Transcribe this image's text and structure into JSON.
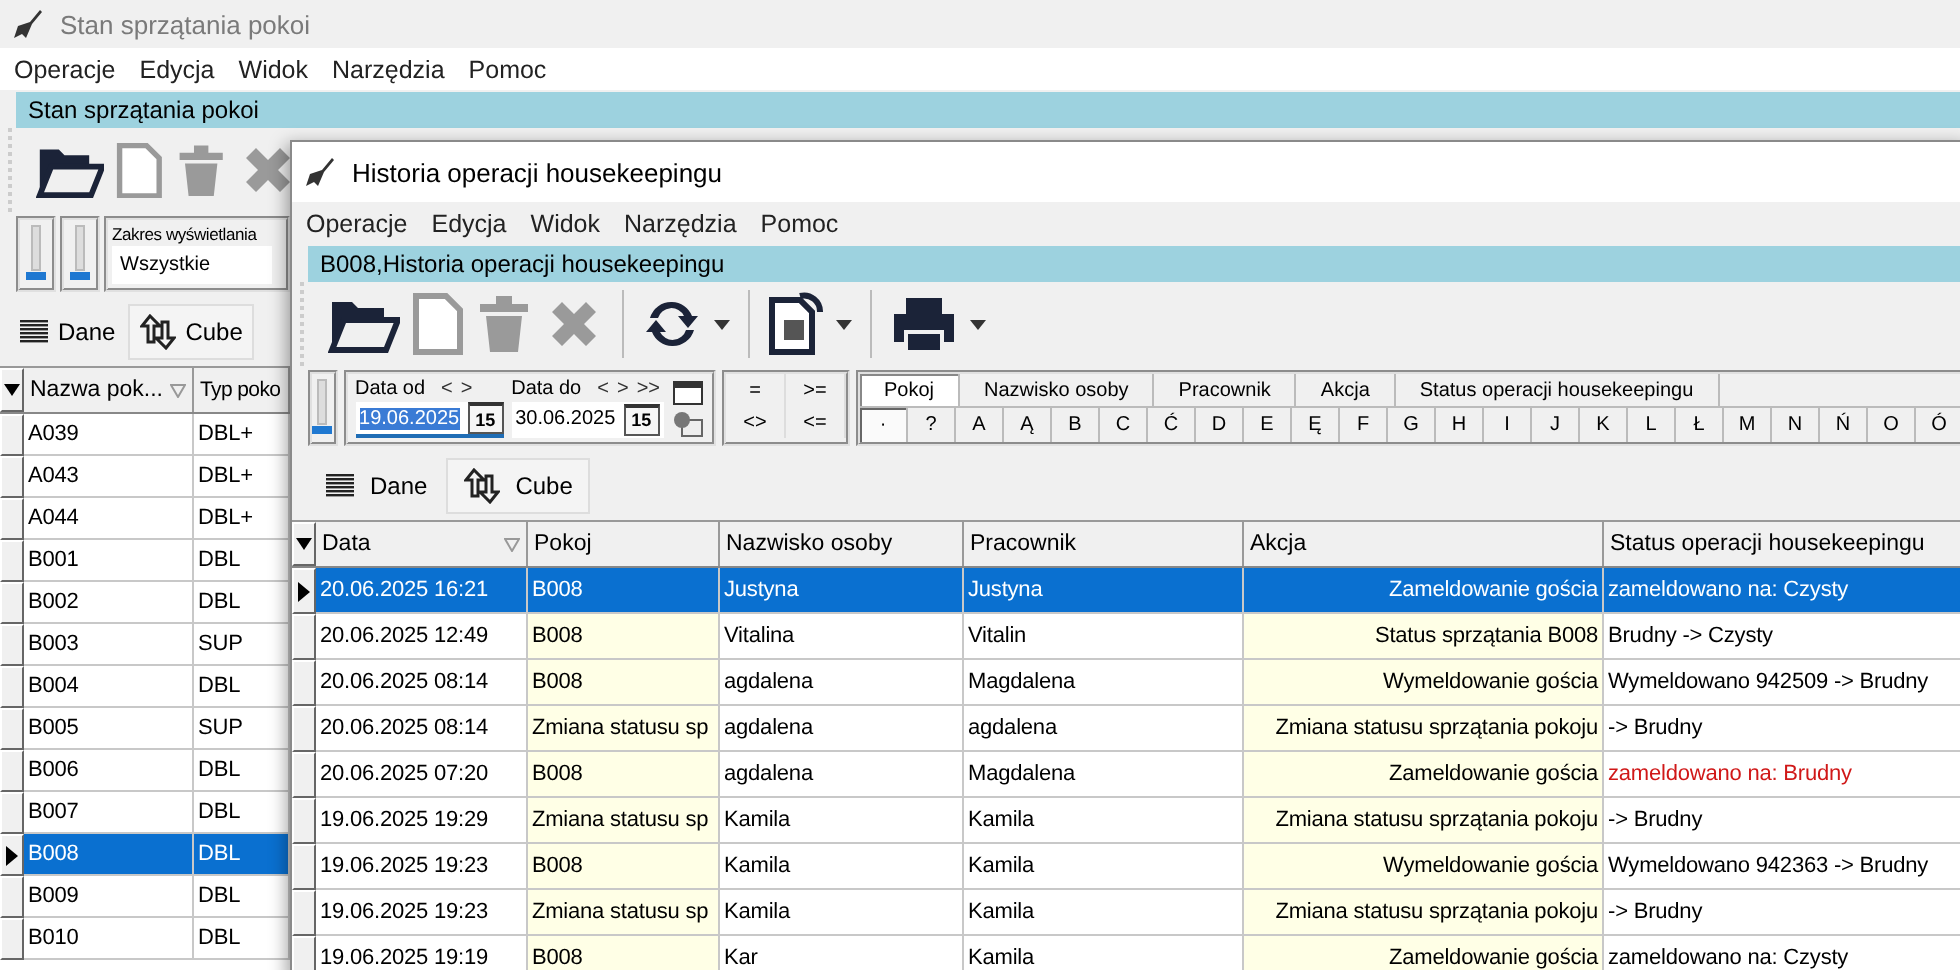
{
  "back_window": {
    "title": "Stan sprzątania pokoi",
    "menu": [
      "Operacje",
      "Edycja",
      "Widok",
      "Narzędzia",
      "Pomoc"
    ],
    "caption": "Stan sprzątania pokoi",
    "range": {
      "label": "Zakres wyświetlania",
      "value": "Wszystkie"
    },
    "view_tabs": [
      {
        "label": "Dane",
        "selected": true
      },
      {
        "label": "Cube",
        "selected": false
      }
    ],
    "table": {
      "columns": [
        "Nazwa pok...",
        "Typ poko"
      ],
      "rows": [
        {
          "cells": [
            "A039",
            "DBL+"
          ],
          "selected": false
        },
        {
          "cells": [
            "A043",
            "DBL+"
          ],
          "selected": false
        },
        {
          "cells": [
            "A044",
            "DBL+"
          ],
          "selected": false
        },
        {
          "cells": [
            "B001",
            "DBL"
          ],
          "selected": false
        },
        {
          "cells": [
            "B002",
            "DBL"
          ],
          "selected": false
        },
        {
          "cells": [
            "B003",
            "SUP"
          ],
          "selected": false
        },
        {
          "cells": [
            "B004",
            "DBL"
          ],
          "selected": false
        },
        {
          "cells": [
            "B005",
            "SUP"
          ],
          "selected": false
        },
        {
          "cells": [
            "B006",
            "DBL"
          ],
          "selected": false
        },
        {
          "cells": [
            "B007",
            "DBL"
          ],
          "selected": false
        },
        {
          "cells": [
            "B008",
            "DBL"
          ],
          "selected": true
        },
        {
          "cells": [
            "B009",
            "DBL"
          ],
          "selected": false
        },
        {
          "cells": [
            "B010",
            "DBL"
          ],
          "selected": false
        }
      ]
    }
  },
  "front_window": {
    "title": "Historia operacji housekeepingu",
    "menu": [
      "Operacje",
      "Edycja",
      "Widok",
      "Narzędzia",
      "Pomoc"
    ],
    "caption": "B008,Historia operacji housekeepingu",
    "date_from": {
      "label": "Data od",
      "nav": [
        "<",
        ">"
      ],
      "value": "19.06.2025",
      "button": "15"
    },
    "date_to": {
      "label": "Data do",
      "nav": [
        "<",
        ">",
        ">>"
      ],
      "value": "30.06.2025",
      "button": "15"
    },
    "operators": [
      "=",
      ">=",
      "<>",
      "<="
    ],
    "filter_tabs": [
      {
        "label": "Pokoj",
        "selected": true
      },
      {
        "label": "Nazwisko osoby",
        "selected": false
      },
      {
        "label": "Pracownik",
        "selected": false
      },
      {
        "label": "Akcja",
        "selected": false
      },
      {
        "label": "Status operacji housekeepingu",
        "selected": false
      }
    ],
    "letters": [
      {
        "label": "·",
        "selected": true
      },
      {
        "label": "?",
        "selected": false
      },
      {
        "label": "A",
        "selected": false
      },
      {
        "label": "Ą",
        "selected": false
      },
      {
        "label": "B",
        "selected": false
      },
      {
        "label": "C",
        "selected": false
      },
      {
        "label": "Ć",
        "selected": false
      },
      {
        "label": "D",
        "selected": false
      },
      {
        "label": "E",
        "selected": false
      },
      {
        "label": "Ę",
        "selected": false
      },
      {
        "label": "F",
        "selected": false
      },
      {
        "label": "G",
        "selected": false
      },
      {
        "label": "H",
        "selected": false
      },
      {
        "label": "I",
        "selected": false
      },
      {
        "label": "J",
        "selected": false
      },
      {
        "label": "K",
        "selected": false
      },
      {
        "label": "L",
        "selected": false
      },
      {
        "label": "Ł",
        "selected": false
      },
      {
        "label": "M",
        "selected": false
      },
      {
        "label": "N",
        "selected": false
      },
      {
        "label": "Ń",
        "selected": false
      },
      {
        "label": "O",
        "selected": false
      },
      {
        "label": "Ó",
        "selected": false
      }
    ],
    "view_tabs": [
      {
        "label": "Dane",
        "selected": true
      },
      {
        "label": "Cube",
        "selected": false
      }
    ],
    "table": {
      "columns": [
        "Data",
        "Pokoj",
        "Nazwisko osoby",
        "Pracownik",
        "Akcja",
        "Status operacji housekeepingu"
      ],
      "rows": [
        {
          "cells": [
            "20.06.2025 16:21",
            "B008",
            "Justyna",
            "Justyna",
            "Zameldowanie gościa",
            "zameldowano na: Czysty"
          ],
          "selected": true,
          "warning": false
        },
        {
          "cells": [
            "20.06.2025 12:49",
            "B008",
            "Vitalina",
            "Vitalin",
            "Status sprzątania B008",
            "Brudny -> Czysty"
          ],
          "selected": false,
          "warning": false
        },
        {
          "cells": [
            "20.06.2025 08:14",
            "B008",
            "agdalena",
            "Magdalena",
            "Wymeldowanie gościa",
            "Wymeldowano 942509 -> Brudny"
          ],
          "selected": false,
          "warning": false
        },
        {
          "cells": [
            "20.06.2025 08:14",
            "Zmiana statusu sp",
            "agdalena",
            "agdalena",
            "Zmiana statusu sprzątania pokoju",
            "-> Brudny"
          ],
          "selected": false,
          "warning": false
        },
        {
          "cells": [
            "20.06.2025 07:20",
            "B008",
            "agdalena",
            "Magdalena",
            "Zameldowanie gościa",
            "zameldowano na: Brudny"
          ],
          "selected": false,
          "warning": true
        },
        {
          "cells": [
            "19.06.2025 19:29",
            "Zmiana statusu sp",
            "Kamila",
            "Kamila",
            "Zmiana statusu sprzątania pokoju",
            "-> Brudny"
          ],
          "selected": false,
          "warning": false
        },
        {
          "cells": [
            "19.06.2025 19:23",
            "B008",
            "Kamila",
            "Kamila",
            "Wymeldowanie gościa",
            "Wymeldowano 942363 -> Brudny"
          ],
          "selected": false,
          "warning": false
        },
        {
          "cells": [
            "19.06.2025 19:23",
            "Zmiana statusu sp",
            "Kamila",
            "Kamila",
            "Zmiana statusu sprzątania pokoju",
            "-> Brudny"
          ],
          "selected": false,
          "warning": false
        },
        {
          "cells": [
            "19.06.2025 19:19",
            "B008",
            "Kar",
            "Kamila",
            "Zameldowanie gościa",
            "zameldowano na: Czysty"
          ],
          "selected": false,
          "warning": false
        }
      ]
    }
  }
}
